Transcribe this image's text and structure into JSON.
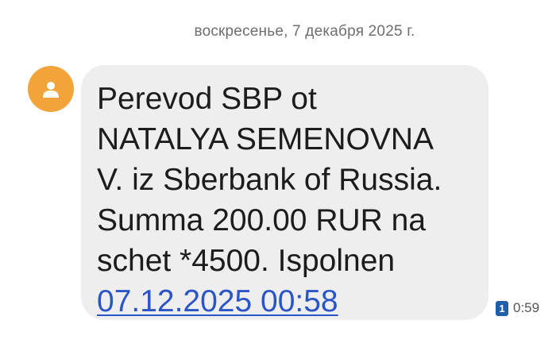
{
  "date_separator": "воскресенье, 7 декабря 2025 г.",
  "contact": {
    "avatar_icon": "person-icon",
    "avatar_color": "#f2a33a"
  },
  "message": {
    "lines": [
      "Perevod SBP ot",
      "NATALYA SEMENOVNA",
      "V. iz Sberbank of Russia.",
      "Summa 200.00 RUR na",
      "schet *4500. Ispolnen"
    ],
    "link_text": "07.12.2025 00:58",
    "sim_slot": "1",
    "time": "0:59",
    "bubble_color": "#eeeeee",
    "link_color": "#2a55c7"
  }
}
